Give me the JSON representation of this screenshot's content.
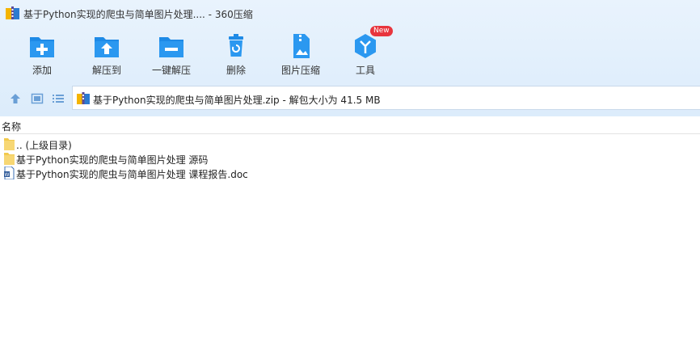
{
  "window": {
    "title": "基于Python实现的爬虫与简单图片处理.... - 360压缩"
  },
  "toolbar": {
    "buttons": [
      {
        "label": "添加",
        "icon": "add-folder-icon"
      },
      {
        "label": "解压到",
        "icon": "extract-to-icon"
      },
      {
        "label": "一键解压",
        "icon": "one-click-extract-icon"
      },
      {
        "label": "删除",
        "icon": "trash-icon"
      },
      {
        "label": "图片压缩",
        "icon": "image-compress-icon"
      },
      {
        "label": "工具",
        "icon": "tools-icon",
        "badge": "New"
      }
    ]
  },
  "nav": {
    "up_icon": "up-arrow-icon",
    "view_icon": "thumbnail-view-icon",
    "list_icon": "list-view-icon"
  },
  "address": {
    "text": "基于Python实现的爬虫与简单图片处理.zip - 解包大小为 41.5 MB"
  },
  "file_list": {
    "column_name": "名称",
    "rows": [
      {
        "name": ".. (上级目录)",
        "type": "folder"
      },
      {
        "name": "基于Python实现的爬虫与简单图片处理 源码",
        "type": "folder"
      },
      {
        "name": "基于Python实现的爬虫与简单图片处理 课程报告.doc",
        "type": "doc"
      }
    ]
  },
  "colors": {
    "accent": "#2b8be6",
    "toolbar_bg": "#e4effb",
    "badge": "#e8353d"
  }
}
